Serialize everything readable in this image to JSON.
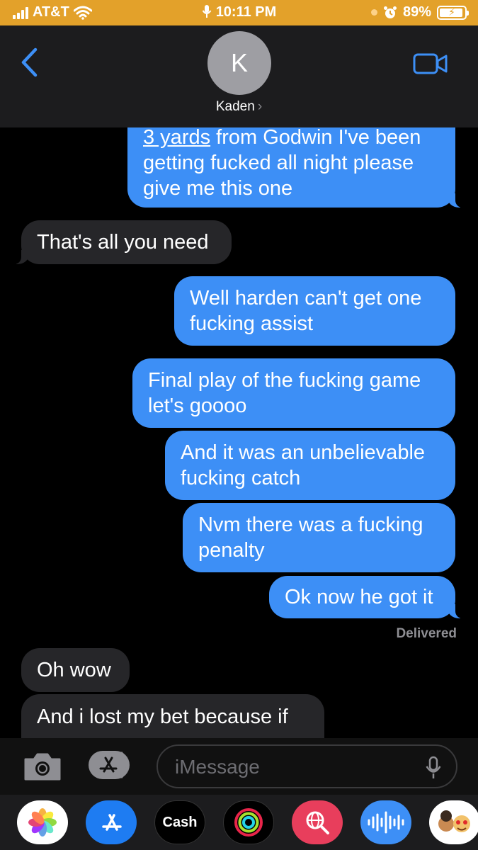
{
  "status_bar": {
    "carrier": "AT&T",
    "time": "10:11 PM",
    "battery": "89%",
    "background_color": "#e3a12a"
  },
  "header": {
    "avatar_initial": "K",
    "contact_name": "Kaden",
    "icons": [
      "back-chevron-icon",
      "facetime-video-icon"
    ]
  },
  "messages": [
    {
      "type": "sent",
      "lines": [
        "3 yards from Godwin I've been",
        "getting fucked all night please",
        "give me this one"
      ],
      "underlined": "3 yards"
    },
    {
      "type": "received",
      "lines": [
        "That's all you need"
      ]
    },
    {
      "type": "sent",
      "lines": [
        "Well harden can't get one",
        "fucking assist"
      ]
    },
    {
      "type": "sent",
      "lines": [
        "Final play of the fucking game",
        "let's goooo"
      ]
    },
    {
      "type": "sent",
      "lines": [
        "And it was an unbelievable",
        "fucking catch"
      ]
    },
    {
      "type": "sent",
      "lines": [
        "Nvm there was a fucking",
        "penalty"
      ]
    },
    {
      "type": "sent",
      "lines": [
        "Ok now he got it"
      ]
    },
    {
      "type": "received",
      "lines": [
        "Oh wow"
      ]
    },
    {
      "type": "received",
      "lines": [
        "And i lost my bet because if"
      ]
    }
  ],
  "delivered_label": "Delivered",
  "input_bar": {
    "placeholder": "iMessage",
    "icons": [
      "camera-icon",
      "app-store-icon",
      "microphone-icon"
    ]
  },
  "app_strip": {
    "apps": [
      {
        "name": "photos",
        "icon": "photos-icon"
      },
      {
        "name": "app-store",
        "icon": "app-store-icon"
      },
      {
        "name": "cash",
        "label": "Cash",
        "icon": "apple-cash-icon"
      },
      {
        "name": "activity",
        "icon": "activity-rings-icon"
      },
      {
        "name": "search-images",
        "icon": "globe-search-icon"
      },
      {
        "name": "audio",
        "icon": "audio-waveform-icon"
      },
      {
        "name": "memoji",
        "icon": "memoji-icon"
      }
    ]
  },
  "colors": {
    "sent_bubble": "#3d8ff6",
    "received_bubble": "#262629",
    "accent": "#3d8ff6"
  }
}
